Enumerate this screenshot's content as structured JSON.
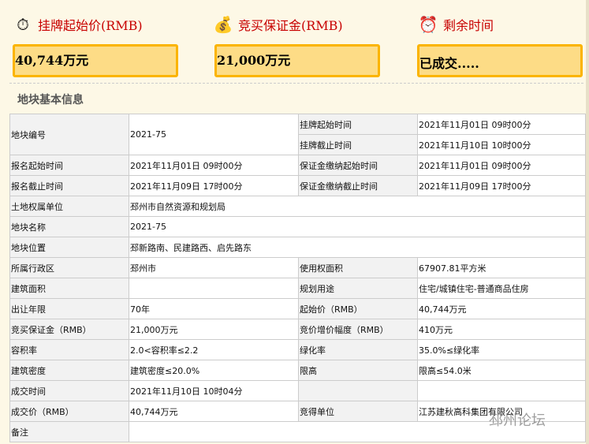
{
  "stats": [
    {
      "icon": "money-clock-icon",
      "title": "挂牌起始价(RMB)",
      "value": "40,744万元"
    },
    {
      "icon": "coins-bag-icon",
      "title": "竞买保证金(RMB)",
      "value": "21,000万元"
    },
    {
      "icon": "alarm-clock-icon",
      "title": "剩余时间",
      "value": "已成交....."
    }
  ],
  "section_title": "地块基本信息",
  "table": {
    "r1": {
      "l1": "地块编号",
      "v1": "2021-75",
      "l2": "挂牌起始时间",
      "v2": "2021年11月01日 09时00分",
      "l3": "挂牌截止时间",
      "v3": "2021年11月10日 10时00分"
    },
    "rows": [
      [
        "报名起始时间",
        "2021年11月01日 09时00分",
        "保证金缴纳起始时间",
        "2021年11月01日 09时00分"
      ],
      [
        "报名截止时间",
        "2021年11月09日 17时00分",
        "保证金缴纳截止时间",
        "2021年11月09日 17时00分"
      ],
      [
        "土地权属单位",
        "邳州市自然资源和规划局"
      ],
      [
        "地块名称",
        "2021-75"
      ],
      [
        "地块位置",
        "邳新路南、民建路西、启先路东"
      ],
      [
        "所属行政区",
        "邳州市",
        "使用权面积",
        "67907.81平方米"
      ],
      [
        "建筑面积",
        "",
        "规划用途",
        "住宅/城镇住宅-普通商品住房"
      ],
      [
        "出让年限",
        "70年",
        "起始价（RMB）",
        "40,744万元"
      ],
      [
        "竞买保证金（RMB）",
        "21,000万元",
        "竞价增价幅度（RMB）",
        "410万元"
      ],
      [
        "容积率",
        "2.0<容积率≤2.2",
        "绿化率",
        "35.0%≤绿化率"
      ],
      [
        "建筑密度",
        "建筑密度≤20.0%",
        "限高",
        "限高≤54.0米"
      ],
      [
        "成交时间",
        "2021年11月10日 10时04分",
        "",
        ""
      ],
      [
        "成交价（RMB）",
        "40,744万元",
        "竞得单位",
        "江苏建秋高科集团有限公司"
      ],
      [
        "备注"
      ]
    ]
  },
  "watermark": "邳州论坛"
}
